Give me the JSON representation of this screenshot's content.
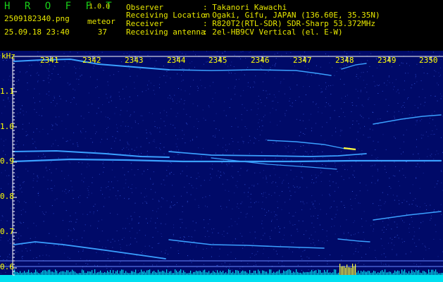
{
  "header": {
    "app_name": "H R O F F T",
    "version": "1.0.0",
    "filename": "2509182340.png",
    "datetime": "25.09.18 23:40",
    "meteor_label": "meteor",
    "meteor_count": "37",
    "info": [
      {
        "label": "Observer",
        "value": ": Takanori Kawachi"
      },
      {
        "label": "Receiving Location",
        "value": ": Ogaki, Gifu, JAPAN (136.60E, 35.35N)"
      },
      {
        "label": "Receiver",
        "value": ": R820T2(RTL-SDR) SDR-Sharp 53.372MHz"
      },
      {
        "label": "Receiving antenna",
        "value": ": 2el-HB9CV Vertical (el. E-W)"
      }
    ]
  },
  "spectrogram": {
    "unit_label": "kHz",
    "time_labels": [
      "2341",
      "2342",
      "2343",
      "2344",
      "2345",
      "2346",
      "2347",
      "2348",
      "2349",
      "2350"
    ],
    "freq_labels": [
      "1.1",
      "1.0",
      "0.9",
      "0.8",
      "0.7",
      "0.6"
    ],
    "colors": {
      "background": "#000a68",
      "axis": "#ffffff",
      "label": "#ffff00",
      "trace": "#3aa0ff",
      "bottom_band": "#00e0f0",
      "noise_peak": "#ffff40"
    }
  }
}
